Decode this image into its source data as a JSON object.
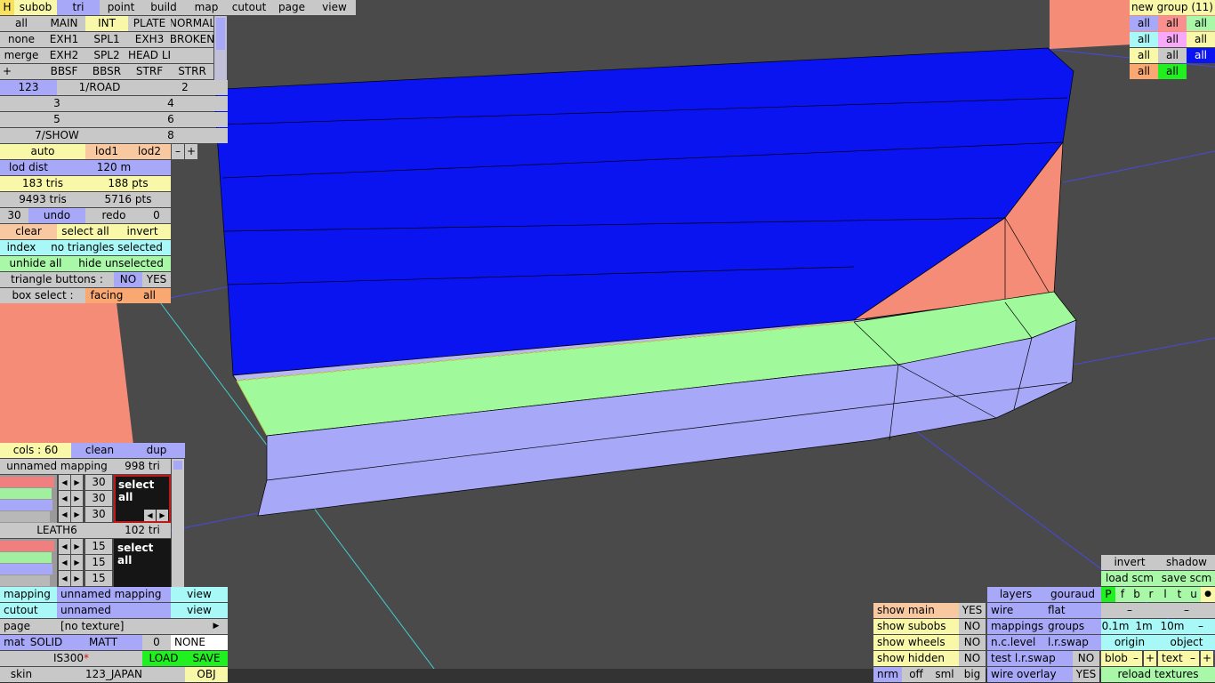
{
  "colors": {
    "viewport_bg": "#4a4a4a",
    "mesh_blue": "#0a14f0",
    "mesh_green": "#a0fa9c",
    "mesh_lavender": "#a8a8f8",
    "mesh_salmon": "#f58c78",
    "btn_grey": "#c8c8c8",
    "btn_yellow": "#f8f8a8",
    "btn_blue": "#a8a8f8",
    "btn_cyan": "#a8f8f8",
    "btn_green": "#a8f8a8",
    "btn_orange": "#f8a870",
    "btn_peach": "#f8c8a0",
    "accent_green": "#20f020"
  },
  "menu": {
    "h": "H",
    "subob": "subob",
    "tri": "tri",
    "point": "point",
    "build": "build",
    "map": "map",
    "cutout": "cutout",
    "page": "page",
    "view": "view"
  },
  "groups": {
    "row1": [
      "all",
      "MAIN",
      "INT",
      "PLATE",
      "NORMAL"
    ],
    "row2": [
      "none",
      "EXH1",
      "SPL1",
      "EXH3",
      "BROKEN"
    ],
    "row3": [
      "merge",
      "EXH2",
      "SPL2",
      "HEAD LI",
      ""
    ],
    "row4": [
      "+",
      "",
      "BBSF",
      "BBSR",
      "STRF",
      "STRR"
    ]
  },
  "lods": {
    "l123": "123",
    "l1road": "1/ROAD",
    "l2": "2",
    "l3": "3",
    "l4": "4",
    "l5": "5",
    "l6": "6",
    "l7show": "7/SHOW",
    "l8": "8"
  },
  "lodctl": {
    "auto": "auto",
    "lod1": "lod1",
    "lod2": "lod2",
    "minus": "–",
    "plus": "+",
    "lod_dist_label": "lod dist",
    "lod_dist_value": "120 m"
  },
  "stats": {
    "tris": "183 tris",
    "pts": "188 pts",
    "total_tris": "9493 tris",
    "total_pts": "5716 pts"
  },
  "undo": {
    "count": "30",
    "undo": "undo",
    "redo": "redo",
    "redo_count": "0"
  },
  "select": {
    "clear": "clear",
    "select_all": "select all",
    "invert": "invert",
    "index": "index",
    "index_status": "no triangles selected",
    "unhide_all": "unhide all",
    "hide_unselected": "hide unselected",
    "tri_buttons_label": "triangle buttons :",
    "no": "NO",
    "yes": "YES",
    "box_select_label": "box select :",
    "facing": "facing",
    "all": "all"
  },
  "mapping": {
    "cols": "cols : 60",
    "clean": "clean",
    "dup": "dup",
    "map1": {
      "name": "unnamed mapping",
      "tris": "998 tri",
      "v1": "30",
      "v2": "30",
      "v3": "30",
      "select_all": "select all",
      "red": 0.95,
      "green": 0.9,
      "blue": 0.92,
      "grey": 0.88
    },
    "map2": {
      "name": "LEATH6",
      "tris": "102 tri",
      "v1": "15",
      "v2": "15",
      "v3": "15",
      "select_all": "select all",
      "red": 0.95,
      "green": 0.9,
      "blue": 0.92,
      "grey": 0.88
    }
  },
  "matpanel": {
    "mapping_label": "mapping",
    "mapping_value": "unnamed mapping",
    "view1": "view",
    "cutout_label": "cutout",
    "cutout_value": "unnamed",
    "view2": "view",
    "page_label": "page",
    "page_value": "[no texture]",
    "page_arrow": "▶",
    "mat": "mat",
    "solid": "SOLID",
    "matt": "MATT",
    "mat_num": "0",
    "none": "NONE",
    "car": "IS300",
    "car_mark": "*",
    "load": "LOAD",
    "save": "SAVE",
    "skin": "skin",
    "skin_value": "123_JAPAN",
    "obj": "OBJ"
  },
  "newgroup": {
    "title": "new group (11)",
    "cells": [
      "all",
      "all",
      "all",
      "all",
      "all",
      "all",
      "all",
      "all",
      "all",
      "all",
      "all"
    ]
  },
  "displaypanel": {
    "invert": "invert",
    "shadow": "shadow",
    "load_scm": "load scm",
    "save_scm": "save scm",
    "layers": "layers",
    "gouraud": "gouraud",
    "flags": [
      "P",
      "f",
      "b",
      "r",
      "l",
      "t",
      "u"
    ],
    "dot": "●",
    "wire": "wire",
    "flat": "flat",
    "dash1": "–",
    "dash2": "–",
    "mappings": "mappings",
    "groups": "groups",
    "d1": "0.1m",
    "d2": "1m",
    "d3": "10m",
    "dminus": "–",
    "nc_level": "n.c.level",
    "lr_swap": "l.r.swap",
    "origin": "origin",
    "object": "object",
    "test_lr_swap": "test l.r.swap",
    "test_no": "NO",
    "blob": "blob",
    "text": "text",
    "wire_overlay": "wire overlay",
    "wire_overlay_yes": "YES",
    "reload_textures": "reload textures",
    "show_main": "show main",
    "show_main_v": "YES",
    "show_subobs": "show subobs",
    "show_subobs_v": "NO",
    "show_wheels": "show wheels",
    "show_wheels_v": "NO",
    "show_hidden": "show hidden",
    "show_hidden_v": "NO",
    "nrm": "nrm",
    "off": "off",
    "sml": "sml",
    "big": "big"
  }
}
